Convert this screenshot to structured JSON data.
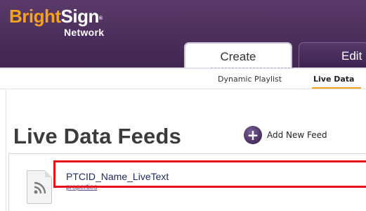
{
  "header": {
    "logo_bright": "Bright",
    "logo_sign": "Sign",
    "logo_tm": "®",
    "logo_sub": "Network",
    "colors": {
      "header_bg": "#4b2e5b",
      "logo_accent": "#f6a21e"
    }
  },
  "tabs": [
    {
      "label": "Create",
      "active": true
    },
    {
      "label": "Edit",
      "active": false
    }
  ],
  "subnav": {
    "items": [
      {
        "label": "Dynamic Playlist",
        "active": false
      },
      {
        "label": "Live Data",
        "active": true
      }
    ]
  },
  "main": {
    "title": "Live Data Feeds",
    "add_feed_label": "Add New Feed",
    "add_icon": "plus-circle-icon",
    "feeds": [
      {
        "name": "PTCID_Name_LiveText",
        "link": "properties",
        "icon": "rss-file-icon"
      }
    ],
    "highlight_color": "#e8141b"
  }
}
